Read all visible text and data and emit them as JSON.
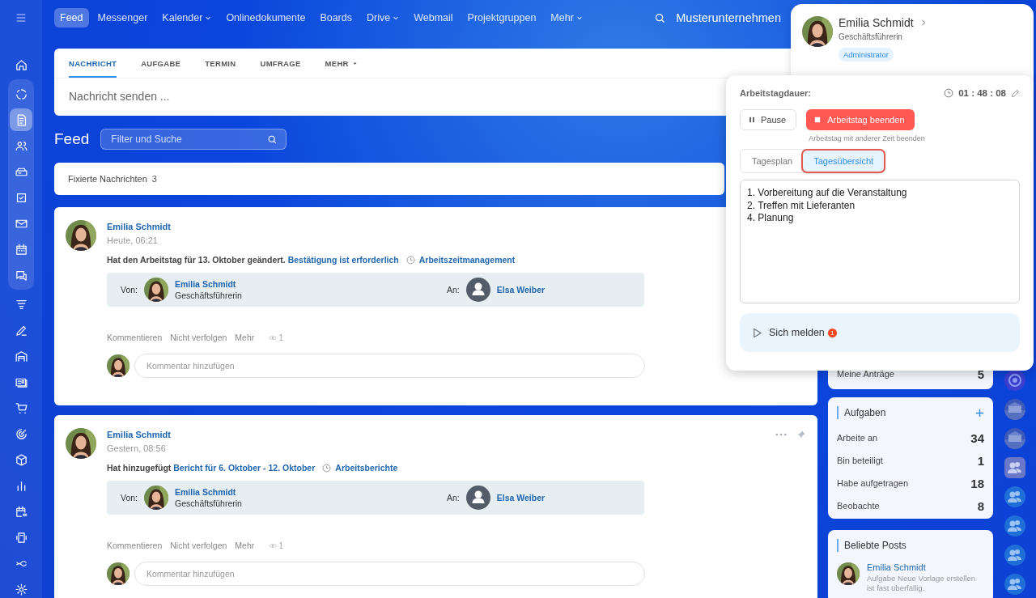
{
  "sidebar": {
    "items": [
      {
        "selected": false
      },
      {
        "selected": false
      },
      {
        "selected": true
      },
      {
        "selected": false
      },
      {
        "selected": false
      },
      {
        "selected": false
      },
      {
        "selected": false
      },
      {
        "selected": false
      },
      {
        "selected": false
      },
      {
        "selected": false
      },
      {
        "selected": false
      },
      {
        "selected": false
      },
      {
        "selected": false
      },
      {
        "selected": false
      },
      {
        "selected": false
      },
      {
        "selected": false
      },
      {
        "selected": false
      },
      {
        "selected": false
      },
      {
        "selected": false
      },
      {
        "selected": false
      },
      {
        "selected": false
      }
    ]
  },
  "top_nav": {
    "items": [
      {
        "label": "Feed",
        "selected": true,
        "has_menu": false
      },
      {
        "label": "Messenger",
        "selected": false,
        "has_menu": false
      },
      {
        "label": "Kalender",
        "selected": false,
        "has_menu": true
      },
      {
        "label": "Onlinedokumente",
        "selected": false,
        "has_menu": false
      },
      {
        "label": "Boards",
        "selected": false,
        "has_menu": false
      },
      {
        "label": "Drive",
        "selected": false,
        "has_menu": true
      },
      {
        "label": "Webmail",
        "selected": false,
        "has_menu": false
      },
      {
        "label": "Projektgruppen",
        "selected": false,
        "has_menu": false
      },
      {
        "label": "Mehr",
        "selected": false,
        "has_menu": true
      }
    ],
    "company": "Musterunternehmen"
  },
  "composer": {
    "tabs": [
      {
        "label": "NACHRICHT",
        "selected": true,
        "has_menu": false
      },
      {
        "label": "AUFGABE",
        "selected": false,
        "has_menu": false
      },
      {
        "label": "TERMIN",
        "selected": false,
        "has_menu": false
      },
      {
        "label": "UMFRAGE",
        "selected": false,
        "has_menu": false
      },
      {
        "label": "MEHR",
        "selected": false,
        "has_menu": true
      }
    ],
    "placeholder": "Nachricht senden ..."
  },
  "feed": {
    "title": "Feed",
    "filter_placeholder": "Filter und Suche",
    "pinned": {
      "label": "Fixierte Nachrichten",
      "count": "3"
    },
    "posts": [
      {
        "author": "Emilia Schmidt",
        "time": "Heute, 06:21",
        "text": "Hat den Arbeitstag für 13. Oktober geändert.",
        "link": "Bestätigung ist erforderlich",
        "category": "Arbeitszeitmanagement",
        "from_label": "Von:",
        "from_name": "Emilia Schmidt",
        "from_role": "Geschäftsführerin",
        "to_label": "An:",
        "to_name": "Elsa Weiber",
        "actions": [
          "Kommentieren",
          "Nicht verfolgen",
          "Mehr"
        ],
        "views": "1",
        "comment_placeholder": "Kommentar hinzufügen"
      },
      {
        "author": "Emilia Schmidt",
        "time": "Gestern, 08:56",
        "text": "Hat hinzugefügt",
        "link": "Bericht für 6. Oktober - 12. Oktober",
        "category": "Arbeitsberichte",
        "from_label": "Von:",
        "from_name": "Emilia Schmidt",
        "from_role": "Geschäftsführerin",
        "to_label": "An:",
        "to_name": "Elsa Weiber",
        "actions": [
          "Kommentieren",
          "Nicht verfolgen",
          "Mehr"
        ],
        "views": "1",
        "comment_placeholder": "Kommentar hinzufügen",
        "menu": true
      }
    ]
  },
  "widgets": {
    "requests": {
      "label": "Meine Anträge",
      "count": "5"
    },
    "tasks": {
      "title": "Aufgaben",
      "rows": [
        {
          "label": "Arbeite an",
          "count": "34"
        },
        {
          "label": "Bin beteiligt",
          "count": "1"
        },
        {
          "label": "Habe aufgetragen",
          "count": "18"
        },
        {
          "label": "Beobachte",
          "count": "8"
        }
      ]
    },
    "popular": {
      "title": "Beliebte Posts",
      "posts": [
        {
          "author": "Emilia Schmidt",
          "text": "Aufgabe Neue Vorlage erstellen ist fast überfällig."
        }
      ]
    }
  },
  "profile": {
    "name": "Emilia Schmidt",
    "role": "Geschäftsführerin",
    "badge": "Administrator"
  },
  "worktime": {
    "label": "Arbeitstagdauer:",
    "timer": "01 : 48 : 08",
    "pause": "Pause",
    "stop": "Arbeitstag beenden",
    "hint": "Arbeitstag mit anderer Zeit beenden",
    "tabs": [
      {
        "label": "Tagesplan",
        "selected": false,
        "highlighted": false
      },
      {
        "label": "Tagesübersicht",
        "selected": true,
        "highlighted": true
      }
    ],
    "report": "1. Vorbereitung auf die Veranstaltung\n2. Treffen mit Lieferanten\n4. Planung",
    "report_button": {
      "label": "Sich melden",
      "badge": "1"
    }
  }
}
